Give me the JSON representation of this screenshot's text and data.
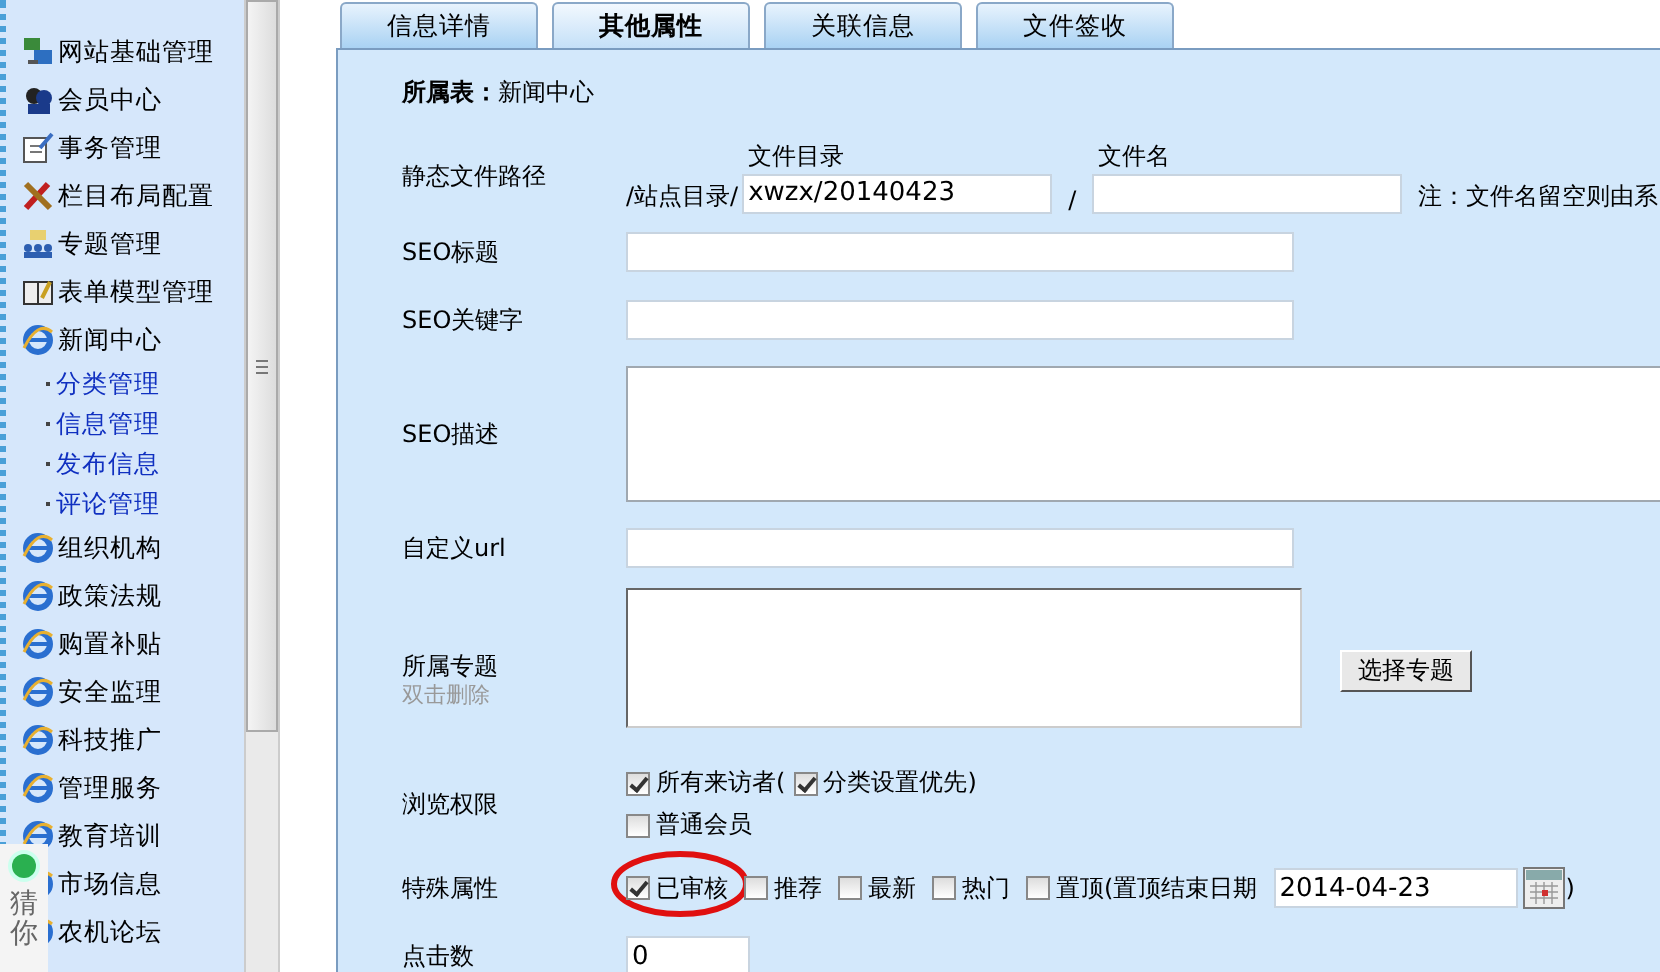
{
  "sidebar": {
    "items": [
      {
        "label": "网站基础管理"
      },
      {
        "label": "会员中心"
      },
      {
        "label": "事务管理"
      },
      {
        "label": "栏目布局配置"
      },
      {
        "label": "专题管理"
      },
      {
        "label": "表单模型管理"
      },
      {
        "label": "新闻中心",
        "children": [
          {
            "label": "分类管理"
          },
          {
            "label": "信息管理"
          },
          {
            "label": "发布信息"
          },
          {
            "label": "评论管理"
          }
        ]
      },
      {
        "label": "组织机构"
      },
      {
        "label": "政策法规"
      },
      {
        "label": "购置补贴"
      },
      {
        "label": "安全监理"
      },
      {
        "label": "科技推广"
      },
      {
        "label": "管理服务"
      },
      {
        "label": "教育培训"
      },
      {
        "label": "市场信息"
      },
      {
        "label": "农机论坛"
      }
    ]
  },
  "floating_widget": {
    "label": "猜你"
  },
  "tabs": [
    {
      "label": "信息详情",
      "selected": false
    },
    {
      "label": "其他属性",
      "selected": true
    },
    {
      "label": "关联信息",
      "selected": false
    },
    {
      "label": "文件签收",
      "selected": false
    }
  ],
  "belongs_table": {
    "label": "所属表：",
    "value": "新闻中心"
  },
  "static_path": {
    "label": "静态文件路径",
    "prefix": "/站点目录/",
    "dir_label": "文件目录",
    "dir_value": "xwzx/20140423",
    "separator": "/",
    "name_label": "文件名",
    "note": "注：文件名留空则由系"
  },
  "text_fields": [
    {
      "label": "SEO标题",
      "kind": "input"
    },
    {
      "label": "SEO关键字",
      "kind": "input"
    },
    {
      "label": "SEO描述",
      "kind": "textarea"
    },
    {
      "label": "自定义url",
      "kind": "input"
    }
  ],
  "topic": {
    "label": "所属专题",
    "hint": "双击删除",
    "button": "选择专题"
  },
  "permissions": {
    "label": "浏览权限",
    "options": [
      {
        "label": "所有来访者(",
        "checked": true
      },
      {
        "label": "分类设置优先)",
        "checked": true
      },
      {
        "label": "普通会员",
        "checked": false
      }
    ]
  },
  "special": {
    "label": "特殊属性",
    "options": [
      {
        "label": "已审核",
        "checked": true,
        "highlighted": true
      },
      {
        "label": "推荐",
        "checked": false,
        "highlighted": false
      },
      {
        "label": "最新",
        "checked": false,
        "highlighted": false
      },
      {
        "label": "热门",
        "checked": false,
        "highlighted": false
      },
      {
        "label": "置顶(置顶结束日期",
        "checked": false,
        "highlighted": false
      }
    ],
    "date_value": "2014-04-23",
    "close_paren": ")"
  },
  "clicks": {
    "label": "点击数",
    "value": "0"
  }
}
